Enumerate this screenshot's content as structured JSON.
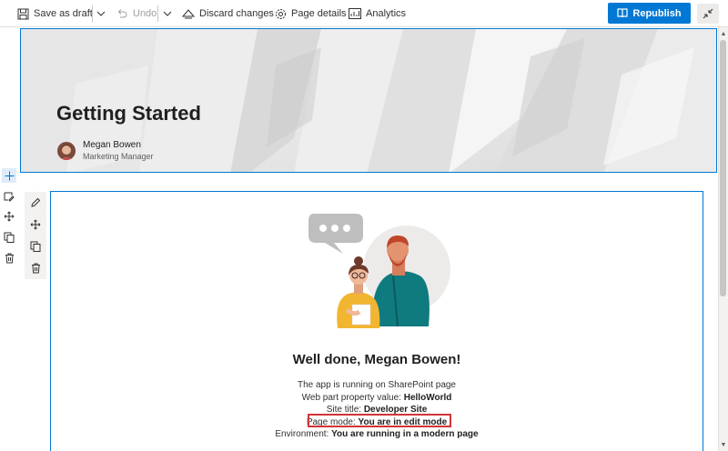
{
  "toolbar": {
    "save_draft": "Save as draft",
    "undo": "Undo",
    "discard": "Discard changes",
    "page_details": "Page details",
    "analytics": "Analytics",
    "republish": "Republish"
  },
  "banner": {
    "title": "Getting Started",
    "author_name": "Megan Bowen",
    "author_role": "Marketing Manager"
  },
  "webpart": {
    "heading": "Well done, Megan Bowen!",
    "line1": "The app is running on SharePoint page",
    "prop_label": "Web part property value: ",
    "prop_value": "HelloWorld",
    "site_label": "Site title: ",
    "site_value": "Developer Site",
    "mode_label": "Page mode: ",
    "mode_value": "You are in edit mode",
    "env_label": "Environment: ",
    "env_value": "You are running in a modern page"
  },
  "colors": {
    "accent": "#0078d4",
    "highlight": "#d13438"
  },
  "icons": [
    "save-icon",
    "undo-icon",
    "discard-icon",
    "gear-icon",
    "analytics-icon",
    "republish-icon",
    "collapse-icon",
    "add-icon",
    "edit-icon",
    "move-icon",
    "duplicate-icon",
    "delete-icon"
  ]
}
